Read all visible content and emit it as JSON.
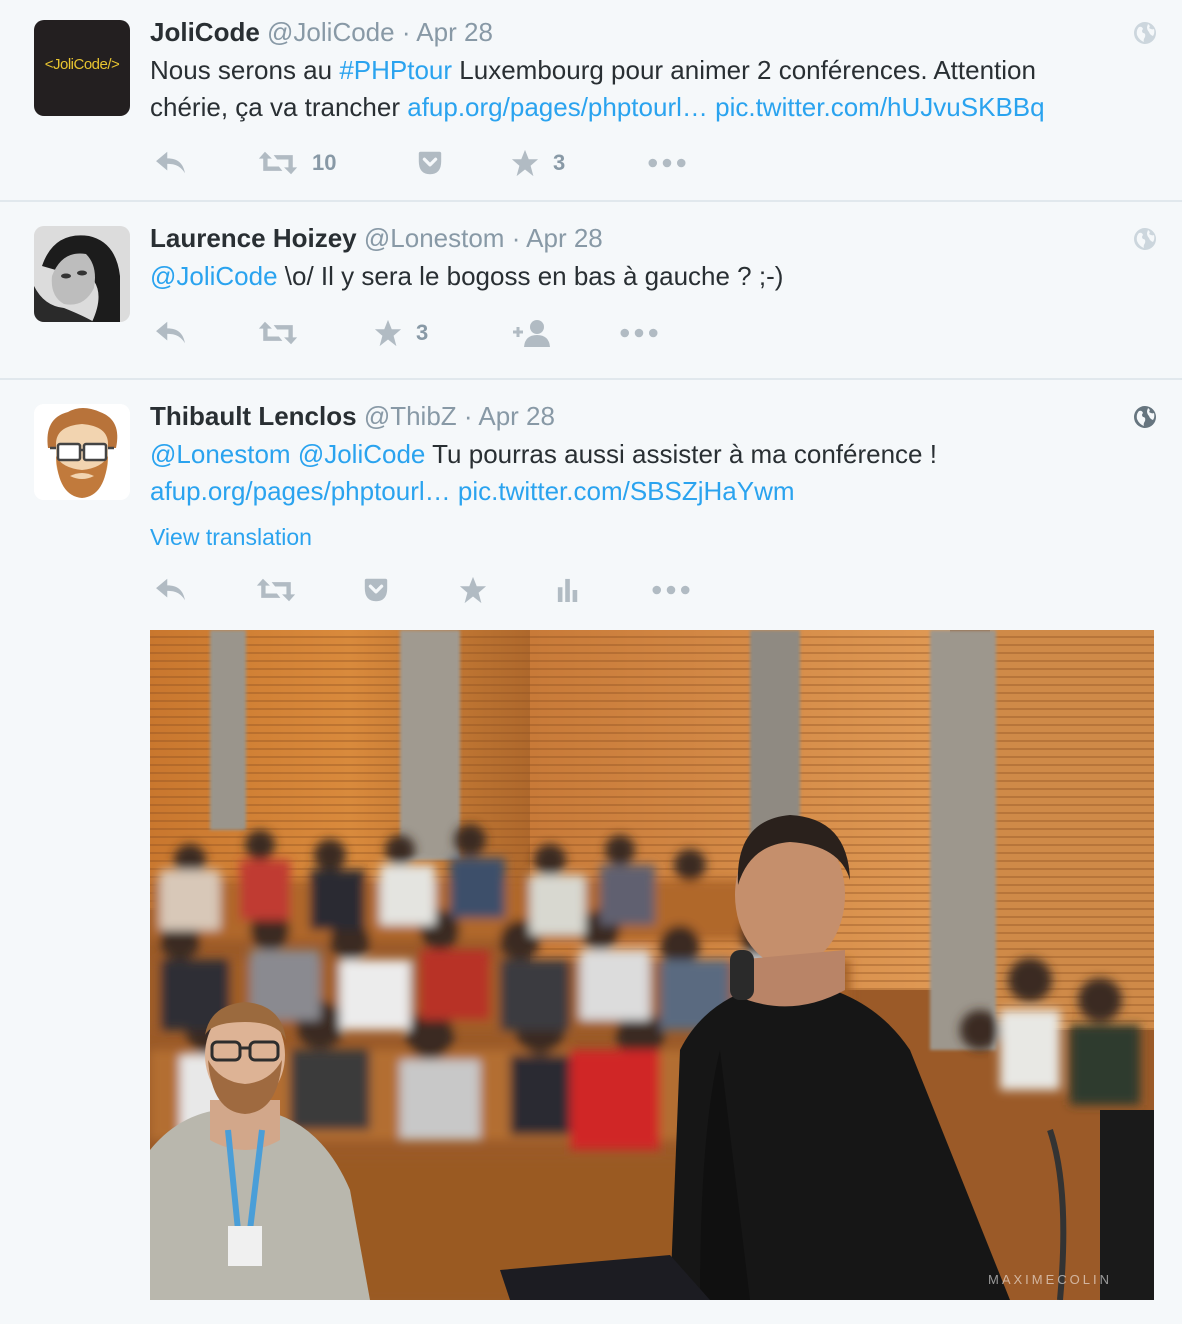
{
  "tweets": [
    {
      "name": "JoliCode",
      "handle": "@JoliCode",
      "separator": "·",
      "date": "Apr 28",
      "avatar_text": "<JoliCode/>",
      "text_pre": "Nous serons au ",
      "hashtag": "#PHPtour",
      "text_mid": " Luxembourg pour animer 2 conférences. Attention",
      "text_line2": "chérie, ça va trancher ",
      "link1": "afup.org/pages/phptourl…",
      "link2": "pic.twitter.com/hUJvuSKBBq",
      "retweets": "10",
      "favorites": "3"
    },
    {
      "name": "Laurence Hoizey",
      "handle": "@Lonestom",
      "separator": "·",
      "date": "Apr 28",
      "mention": "@JoliCode",
      "text": " \\o/ Il y sera le bogoss en bas à gauche ? ;-)",
      "favorites": "3"
    },
    {
      "name": "Thibault Lenclos",
      "handle": "@ThibZ",
      "separator": "·",
      "date": "Apr 28",
      "mention1": "@Lonestom",
      "mention2": "@JoliCode",
      "text": " Tu pourras aussi assister à ma conférence !",
      "link1": "afup.org/pages/phptourl…",
      "link2": "pic.twitter.com/SBSZjHaYwm",
      "view_translation": "View translation",
      "watermark": "MAXIMECOLIN"
    }
  ],
  "colors": {
    "background": "#f5f8fa",
    "link": "#2aa3ef",
    "muted": "#8899a6",
    "icon": "#b1bbc3",
    "divider": "#e1e8ed"
  },
  "icons": [
    "reply-icon",
    "retweet-icon",
    "pocket-icon",
    "favorite-icon",
    "more-icon",
    "follow-icon",
    "analytics-icon",
    "globe-icon"
  ]
}
